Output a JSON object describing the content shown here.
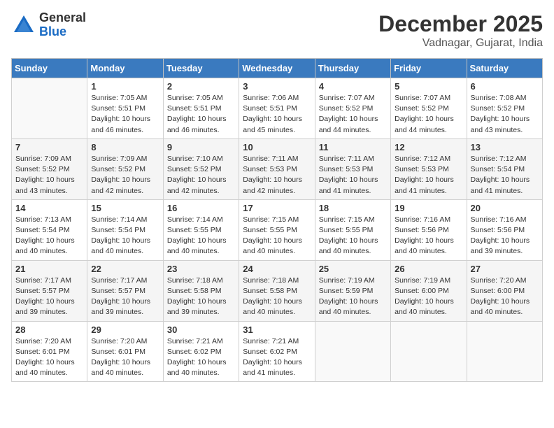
{
  "logo": {
    "general": "General",
    "blue": "Blue"
  },
  "header": {
    "month": "December 2025",
    "location": "Vadnagar, Gujarat, India"
  },
  "weekdays": [
    "Sunday",
    "Monday",
    "Tuesday",
    "Wednesday",
    "Thursday",
    "Friday",
    "Saturday"
  ],
  "weeks": [
    [
      {
        "day": "",
        "info": ""
      },
      {
        "day": "1",
        "info": "Sunrise: 7:05 AM\nSunset: 5:51 PM\nDaylight: 10 hours\nand 46 minutes."
      },
      {
        "day": "2",
        "info": "Sunrise: 7:05 AM\nSunset: 5:51 PM\nDaylight: 10 hours\nand 46 minutes."
      },
      {
        "day": "3",
        "info": "Sunrise: 7:06 AM\nSunset: 5:51 PM\nDaylight: 10 hours\nand 45 minutes."
      },
      {
        "day": "4",
        "info": "Sunrise: 7:07 AM\nSunset: 5:52 PM\nDaylight: 10 hours\nand 44 minutes."
      },
      {
        "day": "5",
        "info": "Sunrise: 7:07 AM\nSunset: 5:52 PM\nDaylight: 10 hours\nand 44 minutes."
      },
      {
        "day": "6",
        "info": "Sunrise: 7:08 AM\nSunset: 5:52 PM\nDaylight: 10 hours\nand 43 minutes."
      }
    ],
    [
      {
        "day": "7",
        "info": "Sunrise: 7:09 AM\nSunset: 5:52 PM\nDaylight: 10 hours\nand 43 minutes."
      },
      {
        "day": "8",
        "info": "Sunrise: 7:09 AM\nSunset: 5:52 PM\nDaylight: 10 hours\nand 42 minutes."
      },
      {
        "day": "9",
        "info": "Sunrise: 7:10 AM\nSunset: 5:52 PM\nDaylight: 10 hours\nand 42 minutes."
      },
      {
        "day": "10",
        "info": "Sunrise: 7:11 AM\nSunset: 5:53 PM\nDaylight: 10 hours\nand 42 minutes."
      },
      {
        "day": "11",
        "info": "Sunrise: 7:11 AM\nSunset: 5:53 PM\nDaylight: 10 hours\nand 41 minutes."
      },
      {
        "day": "12",
        "info": "Sunrise: 7:12 AM\nSunset: 5:53 PM\nDaylight: 10 hours\nand 41 minutes."
      },
      {
        "day": "13",
        "info": "Sunrise: 7:12 AM\nSunset: 5:54 PM\nDaylight: 10 hours\nand 41 minutes."
      }
    ],
    [
      {
        "day": "14",
        "info": "Sunrise: 7:13 AM\nSunset: 5:54 PM\nDaylight: 10 hours\nand 40 minutes."
      },
      {
        "day": "15",
        "info": "Sunrise: 7:14 AM\nSunset: 5:54 PM\nDaylight: 10 hours\nand 40 minutes."
      },
      {
        "day": "16",
        "info": "Sunrise: 7:14 AM\nSunset: 5:55 PM\nDaylight: 10 hours\nand 40 minutes."
      },
      {
        "day": "17",
        "info": "Sunrise: 7:15 AM\nSunset: 5:55 PM\nDaylight: 10 hours\nand 40 minutes."
      },
      {
        "day": "18",
        "info": "Sunrise: 7:15 AM\nSunset: 5:55 PM\nDaylight: 10 hours\nand 40 minutes."
      },
      {
        "day": "19",
        "info": "Sunrise: 7:16 AM\nSunset: 5:56 PM\nDaylight: 10 hours\nand 40 minutes."
      },
      {
        "day": "20",
        "info": "Sunrise: 7:16 AM\nSunset: 5:56 PM\nDaylight: 10 hours\nand 39 minutes."
      }
    ],
    [
      {
        "day": "21",
        "info": "Sunrise: 7:17 AM\nSunset: 5:57 PM\nDaylight: 10 hours\nand 39 minutes."
      },
      {
        "day": "22",
        "info": "Sunrise: 7:17 AM\nSunset: 5:57 PM\nDaylight: 10 hours\nand 39 minutes."
      },
      {
        "day": "23",
        "info": "Sunrise: 7:18 AM\nSunset: 5:58 PM\nDaylight: 10 hours\nand 39 minutes."
      },
      {
        "day": "24",
        "info": "Sunrise: 7:18 AM\nSunset: 5:58 PM\nDaylight: 10 hours\nand 40 minutes."
      },
      {
        "day": "25",
        "info": "Sunrise: 7:19 AM\nSunset: 5:59 PM\nDaylight: 10 hours\nand 40 minutes."
      },
      {
        "day": "26",
        "info": "Sunrise: 7:19 AM\nSunset: 6:00 PM\nDaylight: 10 hours\nand 40 minutes."
      },
      {
        "day": "27",
        "info": "Sunrise: 7:20 AM\nSunset: 6:00 PM\nDaylight: 10 hours\nand 40 minutes."
      }
    ],
    [
      {
        "day": "28",
        "info": "Sunrise: 7:20 AM\nSunset: 6:01 PM\nDaylight: 10 hours\nand 40 minutes."
      },
      {
        "day": "29",
        "info": "Sunrise: 7:20 AM\nSunset: 6:01 PM\nDaylight: 10 hours\nand 40 minutes."
      },
      {
        "day": "30",
        "info": "Sunrise: 7:21 AM\nSunset: 6:02 PM\nDaylight: 10 hours\nand 40 minutes."
      },
      {
        "day": "31",
        "info": "Sunrise: 7:21 AM\nSunset: 6:02 PM\nDaylight: 10 hours\nand 41 minutes."
      },
      {
        "day": "",
        "info": ""
      },
      {
        "day": "",
        "info": ""
      },
      {
        "day": "",
        "info": ""
      }
    ]
  ]
}
